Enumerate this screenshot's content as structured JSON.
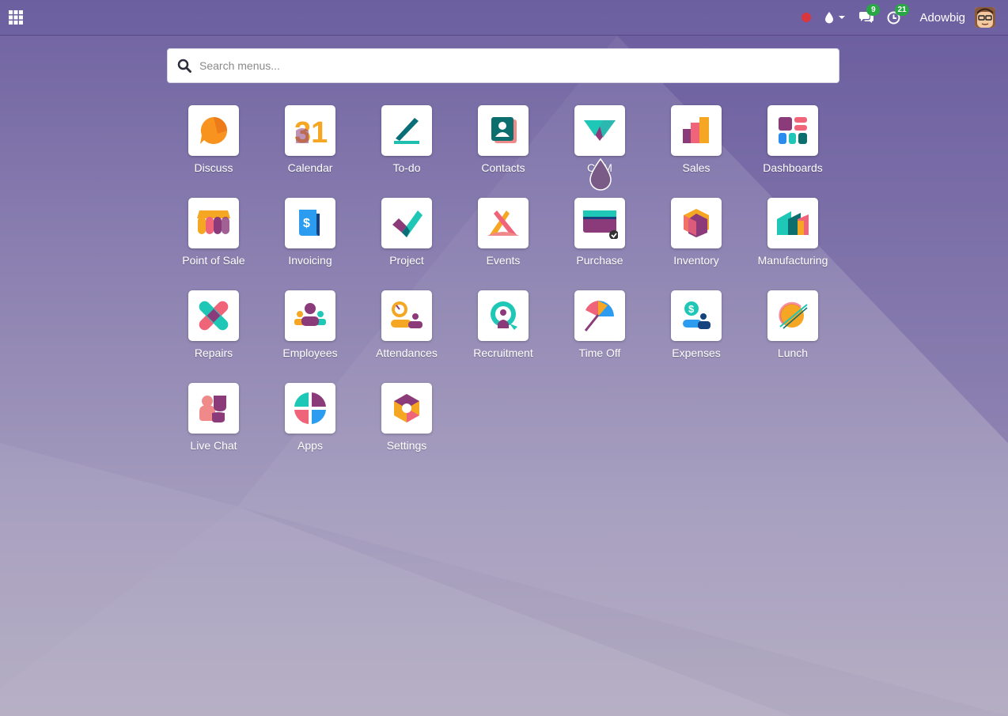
{
  "navbar": {
    "user_name": "Adowbig",
    "messages_count": "9",
    "activities_count": "21"
  },
  "search": {
    "placeholder": "Search menus..."
  },
  "apps": [
    {
      "label": "Discuss",
      "icon": "discuss-icon"
    },
    {
      "label": "Calendar",
      "icon": "calendar-icon"
    },
    {
      "label": "To-do",
      "icon": "todo-icon"
    },
    {
      "label": "Contacts",
      "icon": "contacts-icon"
    },
    {
      "label": "CRM",
      "icon": "crm-icon"
    },
    {
      "label": "Sales",
      "icon": "sales-icon"
    },
    {
      "label": "Dashboards",
      "icon": "dashboards-icon"
    },
    {
      "label": "Point of Sale",
      "icon": "point-of-sale-icon"
    },
    {
      "label": "Invoicing",
      "icon": "invoicing-icon"
    },
    {
      "label": "Project",
      "icon": "project-icon"
    },
    {
      "label": "Events",
      "icon": "events-icon"
    },
    {
      "label": "Purchase",
      "icon": "purchase-icon"
    },
    {
      "label": "Inventory",
      "icon": "inventory-icon"
    },
    {
      "label": "Manufacturing",
      "icon": "manufacturing-icon"
    },
    {
      "label": "Repairs",
      "icon": "repairs-icon"
    },
    {
      "label": "Employees",
      "icon": "employees-icon"
    },
    {
      "label": "Attendances",
      "icon": "attendances-icon"
    },
    {
      "label": "Recruitment",
      "icon": "recruitment-icon"
    },
    {
      "label": "Time Off",
      "icon": "time-off-icon"
    },
    {
      "label": "Expenses",
      "icon": "expenses-icon"
    },
    {
      "label": "Lunch",
      "icon": "lunch-icon"
    },
    {
      "label": "Live Chat",
      "icon": "live-chat-icon"
    },
    {
      "label": "Apps",
      "icon": "apps-icon"
    },
    {
      "label": "Settings",
      "icon": "settings-icon"
    }
  ],
  "calendar_day": "31",
  "colors": {
    "background_top": "#6f62a1",
    "background_bottom": "#b1aac0",
    "badge": "#28a745",
    "record_dot": "#d9363e"
  }
}
